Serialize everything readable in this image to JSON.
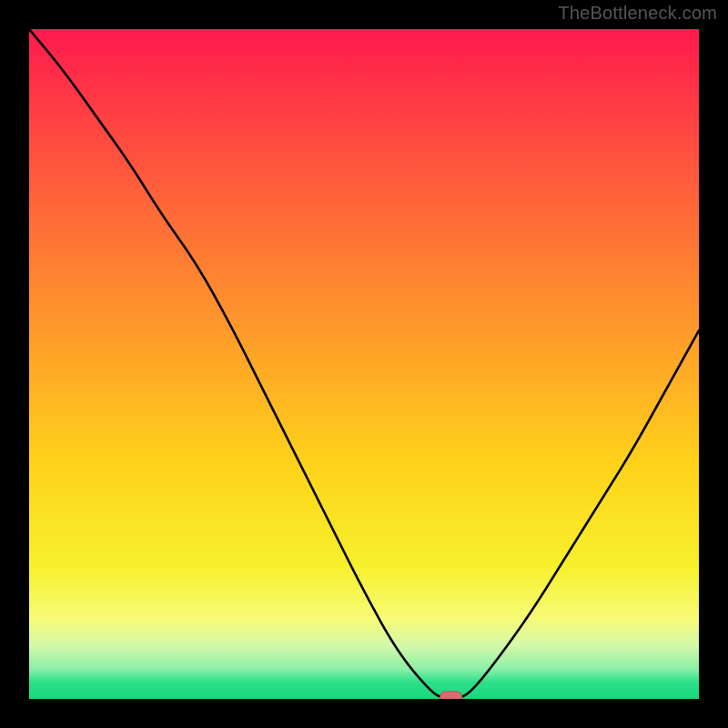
{
  "watermark": "TheBottleneck.com",
  "colors": {
    "frame": "#000000",
    "curve": "#000000",
    "marker_fill": "#de6a6f",
    "marker_stroke": "#c84f56",
    "gradient_stops": [
      {
        "offset": 0.0,
        "color": "#ff1a4e"
      },
      {
        "offset": 0.22,
        "color": "#ff5a3c"
      },
      {
        "offset": 0.45,
        "color": "#ff9a2a"
      },
      {
        "offset": 0.65,
        "color": "#ffd21a"
      },
      {
        "offset": 0.8,
        "color": "#f7f02a"
      },
      {
        "offset": 0.88,
        "color": "#f7fb76"
      },
      {
        "offset": 0.92,
        "color": "#d5f8aa"
      },
      {
        "offset": 0.955,
        "color": "#8cf0a8"
      },
      {
        "offset": 0.975,
        "color": "#2de08a"
      },
      {
        "offset": 1.0,
        "color": "#16d97c"
      }
    ]
  },
  "chart_data": {
    "type": "line",
    "title": "",
    "xlabel": "",
    "ylabel": "",
    "xlim": [
      0,
      100
    ],
    "ylim": [
      0,
      100
    ],
    "grid": false,
    "legend": null,
    "note": "Values estimated from pixels. y=0 at bottom (green), y=100 at top (red).",
    "series": [
      {
        "name": "bottleneck-curve",
        "x": [
          0,
          5,
          10,
          15,
          20,
          25,
          30,
          35,
          40,
          45,
          50,
          55,
          60,
          62,
          64,
          66,
          70,
          75,
          80,
          85,
          90,
          95,
          100
        ],
        "y": [
          100,
          94,
          87,
          80,
          72,
          65,
          56,
          46,
          36,
          26,
          16,
          7,
          1,
          0,
          0,
          1,
          6,
          13,
          21,
          29,
          37,
          46,
          55
        ]
      }
    ],
    "marker": {
      "x": 63,
      "y": 0,
      "shape": "pill"
    }
  }
}
